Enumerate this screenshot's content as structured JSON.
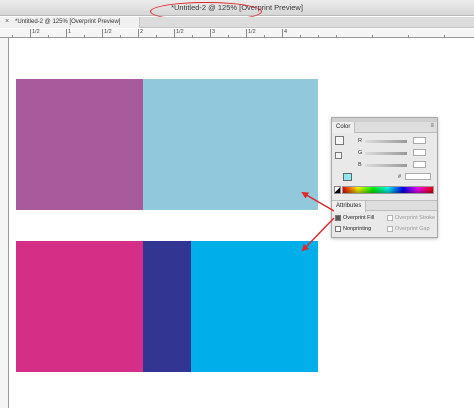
{
  "window": {
    "title": "*Untitled-2 @ 125% [Overprint Preview]"
  },
  "tab": {
    "label": "*Untitled-2 @ 125% [Overprint Preview]",
    "close_glyph": "×"
  },
  "ruler": {
    "labels": [
      "1/2",
      "1",
      "1/2",
      "2",
      "1/2",
      "3",
      "1/2",
      "4"
    ]
  },
  "canvas": {
    "swatches": [
      {
        "name": "purple-square",
        "color": "#a85a9c"
      },
      {
        "name": "light-blue-rect",
        "color": "#92c8dc"
      },
      {
        "name": "magenta-square",
        "color": "#d42e86"
      },
      {
        "name": "indigo-strip",
        "color": "#323591"
      },
      {
        "name": "cyan-rect",
        "color": "#00aeea"
      }
    ]
  },
  "color_panel": {
    "tab_label": "Color",
    "menu_glyph": "≡",
    "channels": [
      {
        "label": "R"
      },
      {
        "label": "G"
      },
      {
        "label": "B"
      }
    ],
    "hex_label": "#",
    "current_color": "#8ee9ee"
  },
  "attributes_panel": {
    "tab_label": "Attributes",
    "checkboxes": [
      {
        "label": "Overprint Fill",
        "checked": true,
        "enabled": true
      },
      {
        "label": "Overprint Stroke",
        "checked": false,
        "enabled": false
      },
      {
        "label": "Nonprinting",
        "checked": false,
        "enabled": true
      },
      {
        "label": "Overprint Gap",
        "checked": false,
        "enabled": false
      }
    ]
  },
  "annotation_color": "#e0262a"
}
